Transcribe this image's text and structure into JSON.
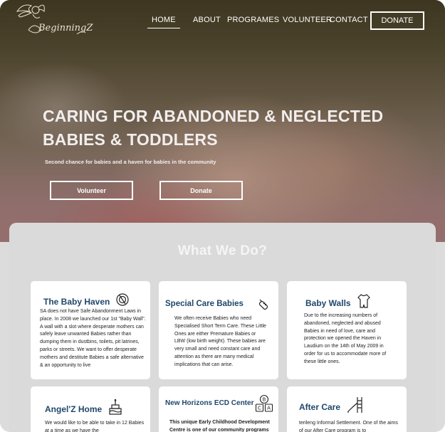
{
  "brand": {
    "logo_text": "BeginningZ"
  },
  "nav": {
    "items": [
      "HOME",
      "ABOUT",
      "PROGRAMES",
      "VOLUNTEER",
      "CONTACT"
    ],
    "donate_label": "DONATE"
  },
  "hero": {
    "title": "CARING FOR ABANDONED & NEGLECTED BABIES & TODDLERS",
    "subtitle": "Second chance for babies and a haven for  babies in the community",
    "volunteer_label": "Volunteer",
    "donate_label": "Donate"
  },
  "section": {
    "title": "What We Do?",
    "cards": [
      {
        "title": "The Baby Haven",
        "icon": "baby-bottle-icon",
        "body": "SA does not have Safe Abandonment Laws in place. In 2008 we launched our 1st \"Baby Wall\". A wall with a slot where desperate mothers can safely leave unwanted Babies rather than dumping them in dustbins, toilets, pit latrines, parks or streets. We want to offer desperate mothers and destitute Babies a safe alternative & an opportunity to live"
      },
      {
        "title": "Special Care Babies",
        "icon": "feeding-bottle-icon",
        "body": "We often receive Babies who need Specialised Short Term Care. These Little Ones are either Premature Babies or LBW (low birth weight). These babies are very small and need constant care and attention as there are many medical implications that can arise."
      },
      {
        "title": "Baby Walls",
        "icon": "onesie-icon",
        "body": "Due to the increasing numbers of abandoned, neglected and abused Babies in need of love, care and protection we opened the Haven in Laudium on the 14th of May 2009 in order for us to accommodate more of these little ones."
      },
      {
        "title": "Angel'Z  Home",
        "icon": "cake-icon",
        "body": "We would like to be able to take in 12 Babies at a time as we have the"
      },
      {
        "title": "New Horizons ECD Center",
        "icon": "abc-blocks-icon",
        "body": "This unique Early Childhood Development Centre is one of our community programs"
      },
      {
        "title": "After Care",
        "icon": "slide-icon",
        "body": "terileng Informal Settlement. One of the aims of our After Care program is to"
      }
    ]
  }
}
